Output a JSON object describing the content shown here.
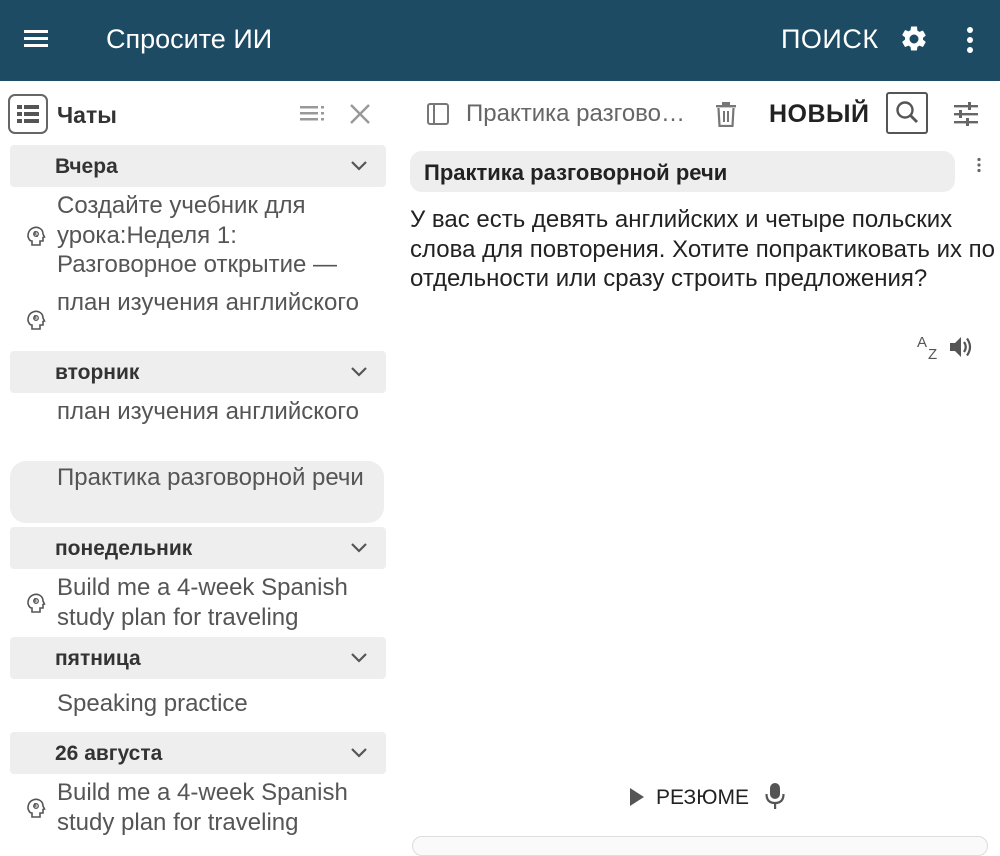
{
  "appbar": {
    "title": "Спросите ИИ",
    "search_label": "ПОИСК",
    "color": "#1d4b63"
  },
  "sidebar": {
    "header_label": "Чаты",
    "groups": [
      {
        "label": "Вчера",
        "items": [
          {
            "text": "Создайте учебник для урока:Неделя 1: Разговорное открытие —",
            "icon": "brain-icon"
          },
          {
            "text": "план изучения английского",
            "icon": "brain-icon"
          }
        ]
      },
      {
        "label": "вторник",
        "items": [
          {
            "text": "план изучения английского",
            "icon": ""
          },
          {
            "text": "Практика разговорной речи",
            "icon": "",
            "selected": true
          }
        ]
      },
      {
        "label": "понедельник",
        "items": [
          {
            "text": "Build me a 4-week Spanish study plan for traveling",
            "icon": "brain-icon"
          }
        ]
      },
      {
        "label": "пятница",
        "items": [
          {
            "text": "Speaking practice",
            "icon": ""
          }
        ]
      },
      {
        "label": "26 августа",
        "items": [
          {
            "text": "Build me a 4-week Spanish study plan for traveling",
            "icon": "brain-icon"
          }
        ]
      }
    ]
  },
  "main": {
    "toolbar_title": "Практика разговорной речи",
    "new_label": "НОВЫЙ",
    "conversation_title": "Практика разговорной речи",
    "message": "У вас есть девять английских и четыре польских слова для повторения. Хотите попрактиковать их по отдельности или сразу строить предложения?",
    "resume_label": "РЕЗЮМЕ"
  }
}
